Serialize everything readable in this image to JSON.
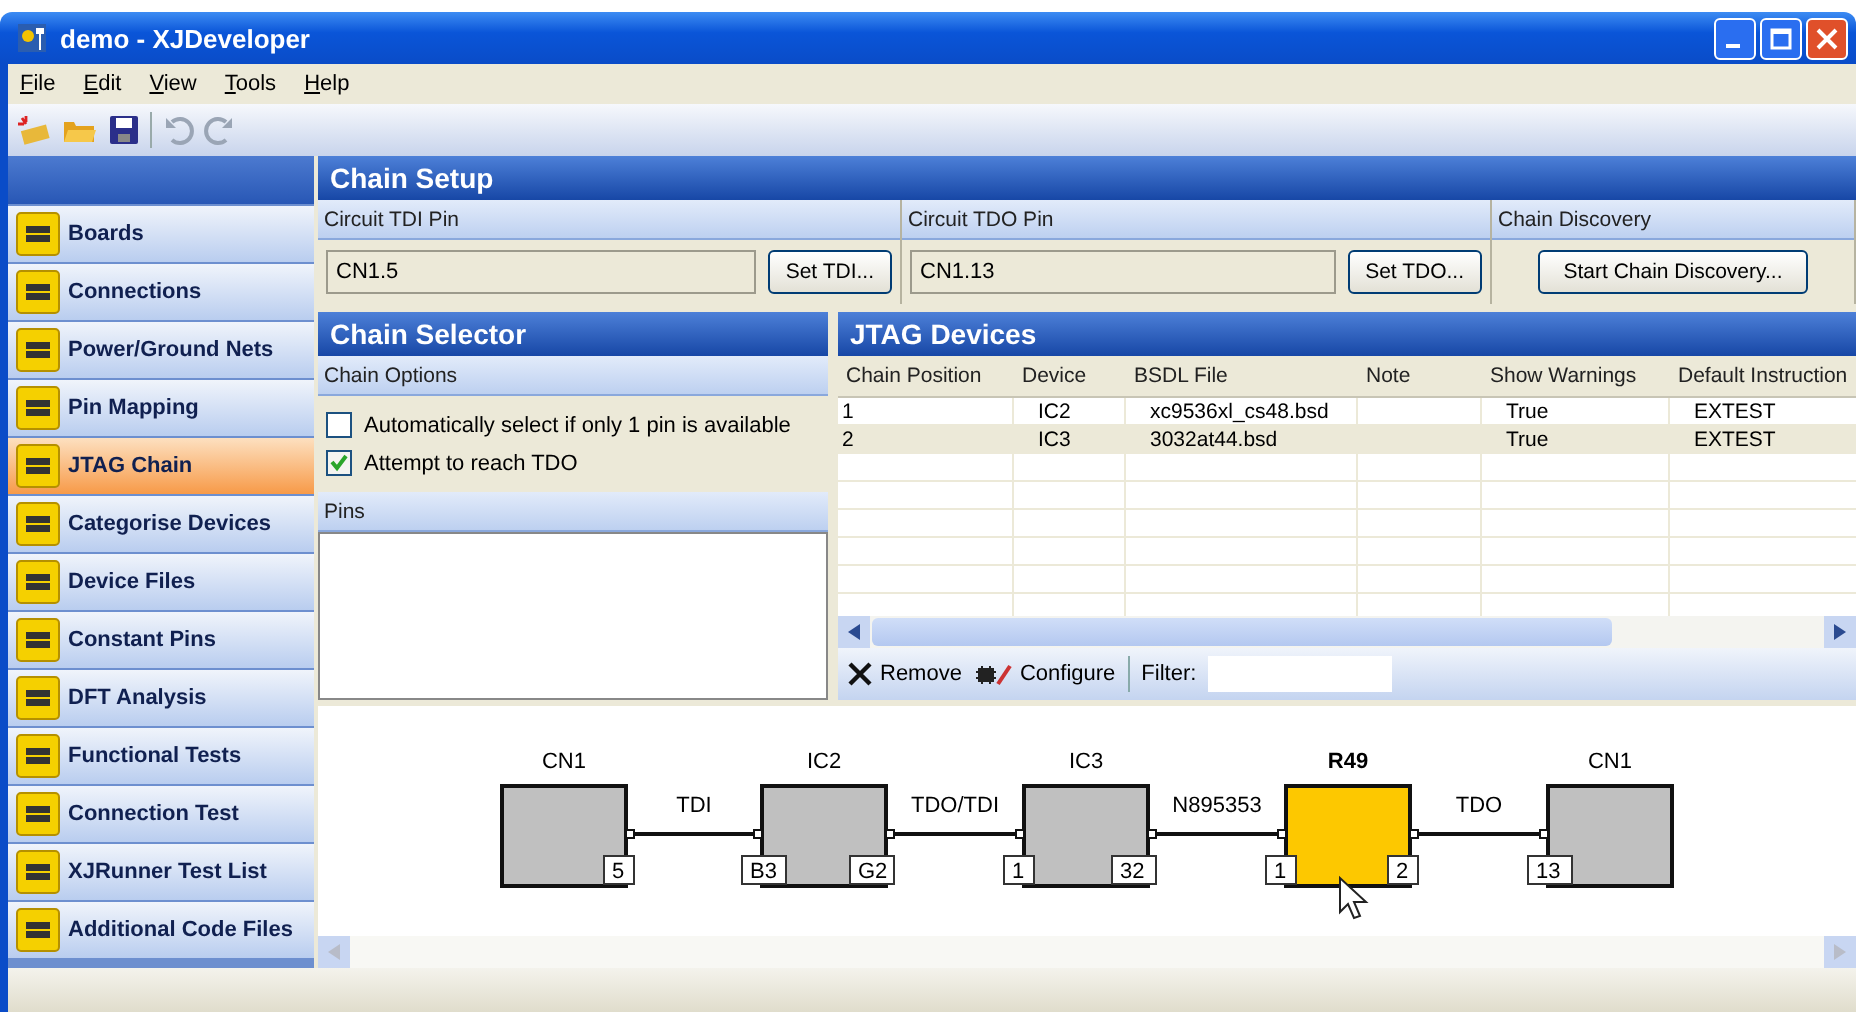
{
  "window": {
    "title": "demo - XJDeveloper"
  },
  "menu": [
    "File",
    "Edit",
    "View",
    "Tools",
    "Help"
  ],
  "sidebar": {
    "items": [
      {
        "label": "Boards",
        "selected": false
      },
      {
        "label": "Connections",
        "selected": false
      },
      {
        "label": "Power/Ground Nets",
        "selected": false
      },
      {
        "label": "Pin Mapping",
        "selected": false
      },
      {
        "label": "JTAG Chain",
        "selected": true
      },
      {
        "label": "Categorise Devices",
        "selected": false
      },
      {
        "label": "Device Files",
        "selected": false
      },
      {
        "label": "Constant Pins",
        "selected": false
      },
      {
        "label": "DFT Analysis",
        "selected": false
      },
      {
        "label": "Functional Tests",
        "selected": false
      },
      {
        "label": "Connection Test",
        "selected": false
      },
      {
        "label": "XJRunner Test List",
        "selected": false
      },
      {
        "label": "Additional Code Files",
        "selected": false
      }
    ]
  },
  "chain_setup": {
    "title": "Chain Setup",
    "tdi": {
      "label": "Circuit TDI Pin",
      "value": "CN1.5",
      "button": "Set TDI..."
    },
    "tdo": {
      "label": "Circuit TDO Pin",
      "value": "CN1.13",
      "button": "Set TDO..."
    },
    "discovery": {
      "label": "Chain Discovery",
      "button": "Start Chain Discovery..."
    }
  },
  "chain_selector": {
    "title": "Chain Selector",
    "options_header": "Chain Options",
    "options": [
      {
        "label": "Automatically select if only 1 pin is available",
        "checked": false
      },
      {
        "label": "Attempt to reach TDO",
        "checked": true
      }
    ],
    "pins_header": "Pins"
  },
  "jtag_devices": {
    "title": "JTAG Devices",
    "columns": [
      "Chain Position",
      "Device",
      "BSDL File",
      "Note",
      "Show Warnings",
      "Default Instruction"
    ],
    "rows": [
      {
        "cells": [
          "1",
          "IC2",
          "xc9536xl_cs48.bsd",
          "",
          "True",
          "EXTEST"
        ],
        "selected": false
      },
      {
        "cells": [
          "2",
          "IC3",
          "3032at44.bsd",
          "",
          "True",
          "EXTEST"
        ],
        "selected": true
      }
    ],
    "remove": "Remove",
    "configure": "Configure",
    "filter_label": "Filter:"
  },
  "diagram": {
    "nodes": [
      {
        "label": "CN1",
        "out_pin": "5",
        "selected": false
      },
      {
        "label": "IC2",
        "in_pin": "B3",
        "out_pin": "G2",
        "selected": false
      },
      {
        "label": "IC3",
        "in_pin": "1",
        "out_pin": "32",
        "selected": false
      },
      {
        "label": "R49",
        "in_pin": "1",
        "out_pin": "2",
        "selected": true
      },
      {
        "label": "CN1",
        "in_pin": "13",
        "selected": false
      }
    ],
    "nets": [
      "TDI",
      "TDO/TDI",
      "N895353",
      "TDO"
    ]
  }
}
